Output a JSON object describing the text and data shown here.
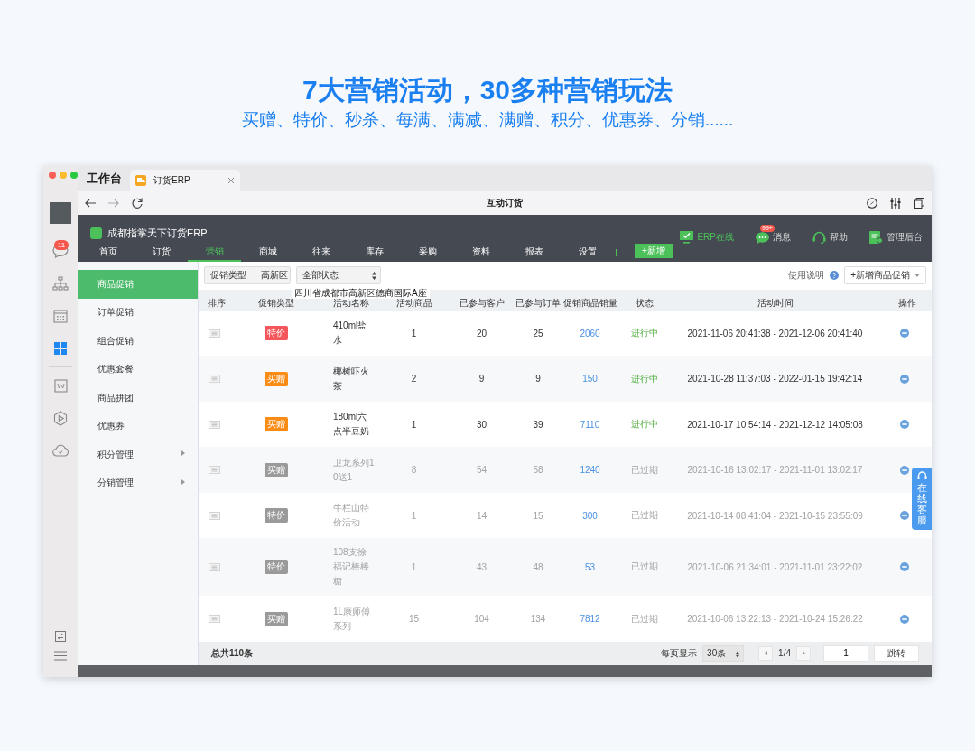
{
  "headline": "7大营销活动，30多种营销玩法",
  "subheadline": "买赠、特价、秒杀、每满、满减、满赠、积分、优惠券、分销......",
  "window": {
    "title": "工作台",
    "tab": {
      "label": "订货ERP"
    },
    "page_title": "互动订货"
  },
  "rail_items": [
    {
      "kind": "chat",
      "badge": "11",
      "selected": false
    },
    {
      "kind": "org",
      "selected": false
    },
    {
      "kind": "calendar",
      "selected": false
    },
    {
      "kind": "grid",
      "selected": true
    },
    {
      "kind": "doc",
      "selected": false
    },
    {
      "kind": "play",
      "selected": false
    },
    {
      "kind": "cloud",
      "selected": false
    }
  ],
  "app": {
    "brand": "成都指掌天下订货ERP",
    "menu": [
      {
        "label": "首页",
        "selected": false
      },
      {
        "label": "订货",
        "selected": false
      },
      {
        "label": "营销",
        "selected": true
      },
      {
        "label": "商城",
        "selected": false
      },
      {
        "label": "往来",
        "selected": false
      },
      {
        "label": "库存",
        "selected": false
      },
      {
        "label": "采购",
        "selected": false
      },
      {
        "label": "资料",
        "selected": false
      },
      {
        "label": "报表",
        "selected": false
      },
      {
        "label": "设置",
        "selected": false
      }
    ],
    "add_button": "+新增",
    "actions": [
      {
        "kind": "monitor",
        "label": "ERP在线",
        "active": true
      },
      {
        "kind": "chat",
        "label": "消息",
        "badge": "99+",
        "active": false
      },
      {
        "kind": "headset",
        "label": "帮助",
        "active": false
      },
      {
        "kind": "clipboard",
        "label": "管理后台",
        "active": false
      }
    ]
  },
  "sidebar": {
    "items": [
      {
        "label": "商品促销",
        "selected": true,
        "submenu": false
      },
      {
        "label": "订单促销",
        "selected": false,
        "submenu": false
      },
      {
        "label": "组合促销",
        "selected": false,
        "submenu": false
      },
      {
        "label": "优惠套餐",
        "selected": false,
        "submenu": false
      },
      {
        "label": "商品拼团",
        "selected": false,
        "submenu": false
      },
      {
        "label": "优惠券",
        "selected": false,
        "submenu": false
      },
      {
        "label": "积分管理",
        "selected": false,
        "submenu": true
      },
      {
        "label": "分销管理",
        "selected": false,
        "submenu": true
      }
    ]
  },
  "toolbar": {
    "type_select": "促销类型",
    "autocomplete": "高新区",
    "status_select": "全部状态",
    "help": "使用说明",
    "add_button": "+新增商品促销",
    "address_suggestion": "四川省成都市高新区德商国际A座"
  },
  "table": {
    "columns": [
      "排序",
      "促销类型",
      "活动名称",
      "活动商品",
      "已参与客户",
      "已参与订单",
      "促销商品销量",
      "状态",
      "活动时间",
      "操作"
    ],
    "rows": [
      {
        "type": {
          "label": "特价",
          "color": "#f5565b"
        },
        "name": "410ml盐水",
        "goods": "1",
        "customers": "20",
        "orders": "25",
        "sales": "2060",
        "status": "进行中",
        "time": "2021-11-06 20:41:38 - 2021-12-06 20:41:40",
        "expired": false
      },
      {
        "type": {
          "label": "买赠",
          "color": "#fa8c16"
        },
        "name": "椰树吓火茶",
        "goods": "2",
        "customers": "9",
        "orders": "9",
        "sales": "150",
        "status": "进行中",
        "time": "2021-10-28 11:37:03 - 2022-01-15 19:42:14",
        "expired": false
      },
      {
        "type": {
          "label": "买赠",
          "color": "#fa8c16"
        },
        "name": "180ml六点半豆奶",
        "goods": "1",
        "customers": "30",
        "orders": "39",
        "sales": "7110",
        "status": "进行中",
        "time": "2021-10-17 10:54:14 - 2021-12-12 14:05:08",
        "expired": false
      },
      {
        "type": {
          "label": "买赠",
          "color": "#9a9a9a"
        },
        "name": "卫龙系列10送1",
        "goods": "8",
        "customers": "54",
        "orders": "58",
        "sales": "1240",
        "status": "已过期",
        "time": "2021-10-16 13:02:17 - 2021-11-01 13:02:17",
        "expired": true
      },
      {
        "type": {
          "label": "特价",
          "color": "#9a9a9a"
        },
        "name": "牛栏山特价活动",
        "goods": "1",
        "customers": "14",
        "orders": "15",
        "sales": "300",
        "status": "已过期",
        "time": "2021-10-14 08:41:04 - 2021-10-15 23:55:09",
        "expired": true
      },
      {
        "type": {
          "label": "特价",
          "color": "#9a9a9a"
        },
        "name": "108支徐福记棒棒糖",
        "goods": "1",
        "customers": "43",
        "orders": "48",
        "sales": "53",
        "status": "已过期",
        "time": "2021-10-06 21:34:01 - 2021-11-01 23:22:02",
        "expired": true
      },
      {
        "type": {
          "label": "买赠",
          "color": "#9a9a9a"
        },
        "name": "1L康师傅系列",
        "goods": "15",
        "customers": "104",
        "orders": "134",
        "sales": "7812",
        "status": "已过期",
        "time": "2021-10-06 13:22:13 - 2021-10-24 15:26:22",
        "expired": true
      }
    ]
  },
  "footer": {
    "total": "总共110条",
    "per_page_label": "每页显示",
    "per_page": "30条",
    "page": "1/4",
    "jump_value": "1",
    "jump_button": "跳转"
  },
  "service_button": "在线客服"
}
